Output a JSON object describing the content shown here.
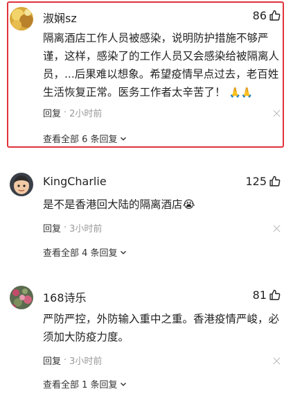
{
  "comments": [
    {
      "username": "淑娴sz",
      "likes": "86",
      "text": "隔离酒店工作人员被感染，说明防护措施不够严谨，这样，感染了的工作人员又会感染给被隔离人员，...后果难以想象。希望疫情早点过去，老百姓生活恢复正常。医务工作者太辛苦了！",
      "emoji": "🙏🙏",
      "reply_label": "回复",
      "time": "2小时前",
      "view_replies": "查看全部 6 条回复",
      "highlighted": true
    },
    {
      "username": "KingCharlie",
      "likes": "125",
      "text": "是不是香港回大陆的隔离酒店",
      "emoji": "😭",
      "reply_label": "回复",
      "time": "3小时前",
      "view_replies": "查看全部 4 条回复"
    },
    {
      "username": "168诗乐",
      "likes": "81",
      "text": "严防严控，外防输入重中之重。香港疫情严峻，必须加大防疫力度。",
      "reply_label": "回复",
      "time": "3小时前",
      "view_replies": "查看全部 1 条回复"
    }
  ],
  "colors": {
    "highlight_border": "#e0313b",
    "meta_gray": "#999999",
    "text": "#222222"
  },
  "icons": {
    "like": "thumbs-up-icon",
    "close": "close-icon",
    "chevron": "chevron-down-icon"
  }
}
